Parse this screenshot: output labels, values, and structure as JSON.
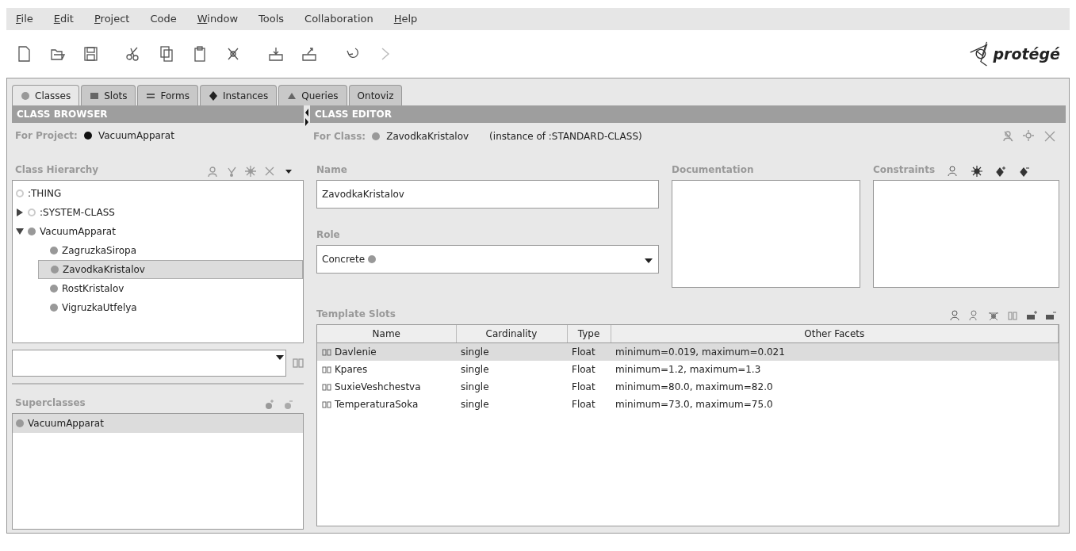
{
  "menu": [
    {
      "label": "File",
      "mnemonic": true
    },
    {
      "label": "Edit",
      "mnemonic": true
    },
    {
      "label": "Project",
      "mnemonic": true
    },
    {
      "label": "Code",
      "mnemonic": false
    },
    {
      "label": "Window",
      "mnemonic": true
    },
    {
      "label": "Tools",
      "mnemonic": false
    },
    {
      "label": "Collaboration",
      "mnemonic": false
    },
    {
      "label": "Help",
      "mnemonic": true
    }
  ],
  "logo": {
    "text": "protégé"
  },
  "tabs": [
    {
      "label": "Classes",
      "kind": "circle",
      "selected": true
    },
    {
      "label": "Slots",
      "kind": "square",
      "selected": false
    },
    {
      "label": "Forms",
      "kind": "lines",
      "selected": false
    },
    {
      "label": "Instances",
      "kind": "diamond",
      "selected": false
    },
    {
      "label": "Queries",
      "kind": "triangle",
      "selected": false
    },
    {
      "label": "Ontoviz",
      "kind": "none",
      "selected": false
    }
  ],
  "class_browser": {
    "title": "CLASS BROWSER",
    "project_label": "For Project:",
    "project": "VacuumApparat",
    "hierarchy_title": "Class Hierarchy",
    "tree": [
      {
        "label": ":THING",
        "kind": "system",
        "selected": false,
        "children": [
          {
            "label": ":SYSTEM-CLASS",
            "kind": "system",
            "selected": false,
            "expanded": false
          },
          {
            "label": "VacuumApparat",
            "kind": "class",
            "selected": false,
            "expanded": true,
            "children": [
              {
                "label": "ZagruzkaSiropa",
                "kind": "class",
                "selected": false
              },
              {
                "label": "ZavodkaKristalov",
                "kind": "class",
                "selected": true
              },
              {
                "label": "RostKristalov",
                "kind": "class",
                "selected": false
              },
              {
                "label": "VigruzkaUtfelya",
                "kind": "class",
                "selected": false
              }
            ]
          }
        ]
      }
    ],
    "superclasses_title": "Superclasses",
    "superclasses": [
      {
        "label": "VacuumApparat",
        "selected": true
      }
    ]
  },
  "class_editor": {
    "title": "CLASS EDITOR",
    "class_label": "For Class:",
    "class_name": "ZavodkaKristalov",
    "instance_of": "(instance of :STANDARD-CLASS)",
    "name_label": "Name",
    "name_value": "ZavodkaKristalov",
    "documentation_label": "Documentation",
    "constraints_label": "Constraints",
    "role_label": "Role",
    "role_value": "Concrete",
    "template_slots_title": "Template Slots",
    "columns": [
      "Name",
      "Cardinality",
      "Type",
      "Other Facets"
    ],
    "rows": [
      {
        "cells": [
          "Davlenie",
          "single",
          "Float",
          "minimum=0.019, maximum=0.021"
        ],
        "selected": true
      },
      {
        "cells": [
          "Kpares",
          "single",
          "Float",
          "minimum=1.2, maximum=1.3"
        ],
        "selected": false
      },
      {
        "cells": [
          "SuxieVeshchestva",
          "single",
          "Float",
          "minimum=80.0, maximum=82.0"
        ],
        "selected": false
      },
      {
        "cells": [
          "TemperaturaSoka",
          "single",
          "Float",
          "minimum=73.0, maximum=75.0"
        ],
        "selected": false
      }
    ]
  }
}
